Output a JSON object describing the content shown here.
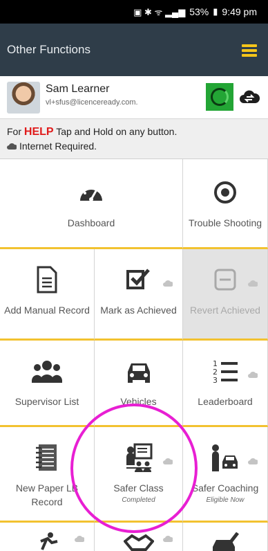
{
  "status_bar": {
    "battery": "53%",
    "time": "9:49 pm"
  },
  "app_bar": {
    "title": "Other Functions",
    "accent": "#f5c51a",
    "background": "#2f3d49"
  },
  "user": {
    "name": "Sam Learner",
    "email": "vl+sfus@licenceready.com."
  },
  "help": {
    "prefix": "For",
    "highlight": "HELP",
    "text": "Tap and Hold on any button.",
    "internet": "Internet Required."
  },
  "tiles": [
    {
      "label": "Dashboard",
      "icon": "gauge-icon"
    },
    {
      "label": "Trouble Shooting",
      "icon": "target-icon"
    },
    {
      "label": "Add Manual Record",
      "icon": "document-icon"
    },
    {
      "label": "Mark as Achieved",
      "icon": "checkbox-icon"
    },
    {
      "label": "Revert Achieved",
      "icon": "minus-box-icon"
    },
    {
      "label": "Supervisor List",
      "icon": "group-icon"
    },
    {
      "label": "Vehicles",
      "icon": "car-icon"
    },
    {
      "label": "Leaderboard",
      "icon": "ordered-list-icon"
    },
    {
      "label": "New Paper LB Record",
      "icon": "notebook-icon"
    },
    {
      "label": "Safer Class",
      "sub": "Completed",
      "icon": "classroom-icon"
    },
    {
      "label": "Safer Coaching",
      "sub": "Eligible Now",
      "icon": "coaching-icon"
    }
  ]
}
